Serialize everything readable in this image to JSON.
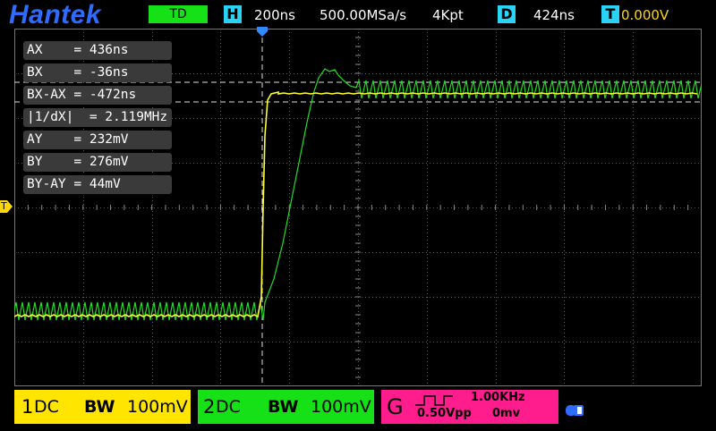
{
  "header": {
    "brand": "Hantek",
    "mode": "TD",
    "timebase_letter": "H",
    "timebase": "200ns",
    "sample_rate": "500.00MSa/s",
    "memory_depth": "4Kpt",
    "delay_letter": "D",
    "delay": "424ns",
    "trigger_letter": "T",
    "trigger_level": "0.000V"
  },
  "cursors": [
    "AX    = 436ns",
    "BX    = -36ns",
    "BX-AX = -472ns",
    "|1/dX|  = 2.119MHz",
    "AY    = 232mV",
    "BY    = 276mV",
    "BY-AY = 44mV"
  ],
  "channels": [
    {
      "num": "1",
      "coupling": "DC",
      "bw": "BW",
      "scale": "100mV",
      "color": "#ffe500"
    },
    {
      "num": "2",
      "coupling": "DC",
      "bw": "BW",
      "scale": "100mV",
      "color": "#16e016"
    }
  ],
  "generator": {
    "letter": "G",
    "frequency": "1.00KHz",
    "amplitude": "0.50Vpp",
    "offset": "0mv",
    "color": "#ff1d8e"
  },
  "markers": {
    "trigger_marker": "T"
  },
  "colors": {
    "logo": "#2f6bff",
    "accent_cyan": "#2ad3f5",
    "trace_ch1": "#ffff33",
    "trace_ch2": "#22dd22",
    "grid": "#5a5a5a"
  }
}
